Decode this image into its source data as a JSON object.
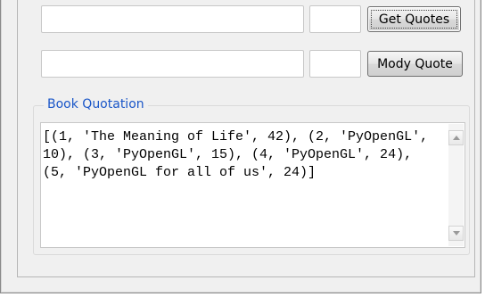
{
  "quote_form": {
    "row1": {
      "title_value": "",
      "page_value": "",
      "button_label": "Get Quotes"
    },
    "row2": {
      "title_value": "",
      "page_value": "",
      "button_label": "Mody Quote"
    }
  },
  "book_quotation": {
    "legend": "Book Quotation",
    "text": "[(1, 'The Meaning of Life', 42), (2, 'PyOpenGL', 10), (3, 'PyOpenGL', 15), (4, 'PyOpenGL', 24), (5, 'PyOpenGL for all of us', 24)]"
  },
  "colors": {
    "window_bg": "#f0f0f0",
    "legend_text": "#1a56c8",
    "field_bg": "#ffffff"
  },
  "icons": {
    "scroll_up": "scroll-up-arrow-icon",
    "scroll_down": "scroll-down-arrow-icon"
  }
}
